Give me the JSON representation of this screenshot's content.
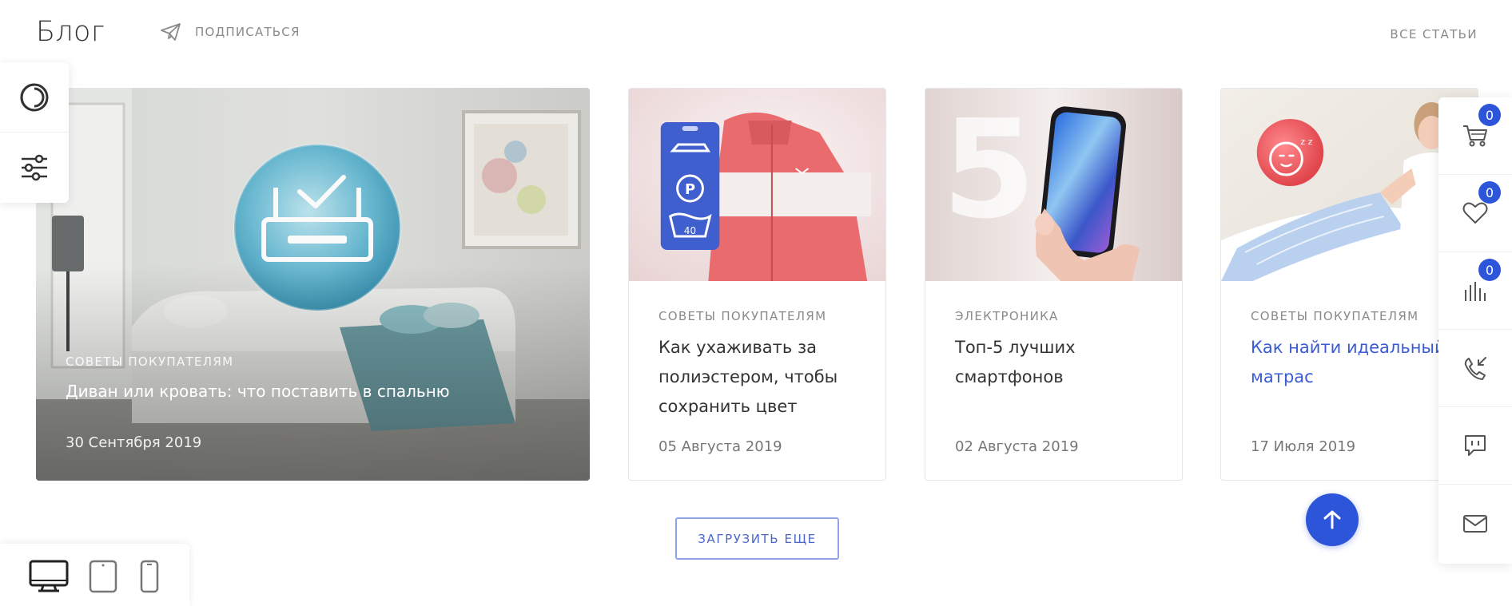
{
  "header": {
    "title": "Блог",
    "subscribe_label": "ПОДПИСАТЬСЯ",
    "all_articles_label": "ВСЕ СТАТЬИ"
  },
  "featured": {
    "category": "СОВЕТЫ ПОКУПАТЕЛЯМ",
    "title": "Диван или кровать: что поставить в спальню",
    "date": "30 Сентября 2019"
  },
  "cards": [
    {
      "category": "СОВЕТЫ ПОКУПАТЕЛЯМ",
      "title": "Как ухаживать за полиэстером, чтобы сохранить цвет",
      "date": "05 Августа 2019",
      "image_label": "40"
    },
    {
      "category": "ЭЛЕКТРОНИКА",
      "title": "Топ-5 лучших смартфонов",
      "date": "02 Августа 2019",
      "image_label": "5"
    },
    {
      "category": "СОВЕТЫ ПОКУПАТЕЛЯМ",
      "title": "Как найти идеальный матрас",
      "date": "17 Июля 2019"
    }
  ],
  "right_panel": {
    "cart_count": "0",
    "favorites_count": "0",
    "compare_count": "0"
  },
  "load_more_label": "ЗАГРУЗИТЬ ЕЩЕ",
  "colors": {
    "accent": "#2d55d9",
    "link": "#3a5ad6",
    "muted": "#8a8a8a"
  },
  "icons": [
    "send-icon",
    "theme-icon",
    "filter-sliders-icon",
    "cart-icon",
    "heart-icon",
    "compare-bars-icon",
    "callback-phone-icon",
    "chat-icon",
    "mail-icon",
    "arrow-up-icon",
    "desktop-icon",
    "tablet-icon",
    "mobile-icon"
  ]
}
